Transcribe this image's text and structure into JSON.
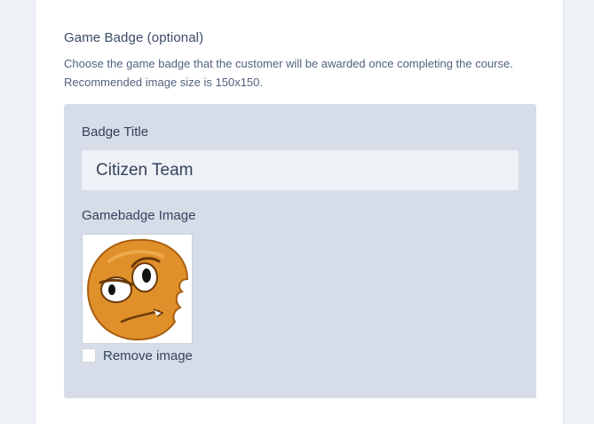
{
  "section": {
    "title": "Game Badge (optional)",
    "description": "Choose the game badge that the customer will be awarded once completing the course. Recommended image size is 150x150."
  },
  "badge": {
    "title_label": "Badge Title",
    "title_value": "Citizen Team",
    "image_label": "Gamebadge Image",
    "image_icon": "orange-cookie-face-icon",
    "remove_label": "Remove image",
    "remove_checked": false
  },
  "colors": {
    "page_bg": "#eef1f6",
    "panel_bg": "#d6dde8",
    "input_bg": "#eef1f6",
    "text": "#34425c",
    "badge_orange": "#e0902a"
  }
}
